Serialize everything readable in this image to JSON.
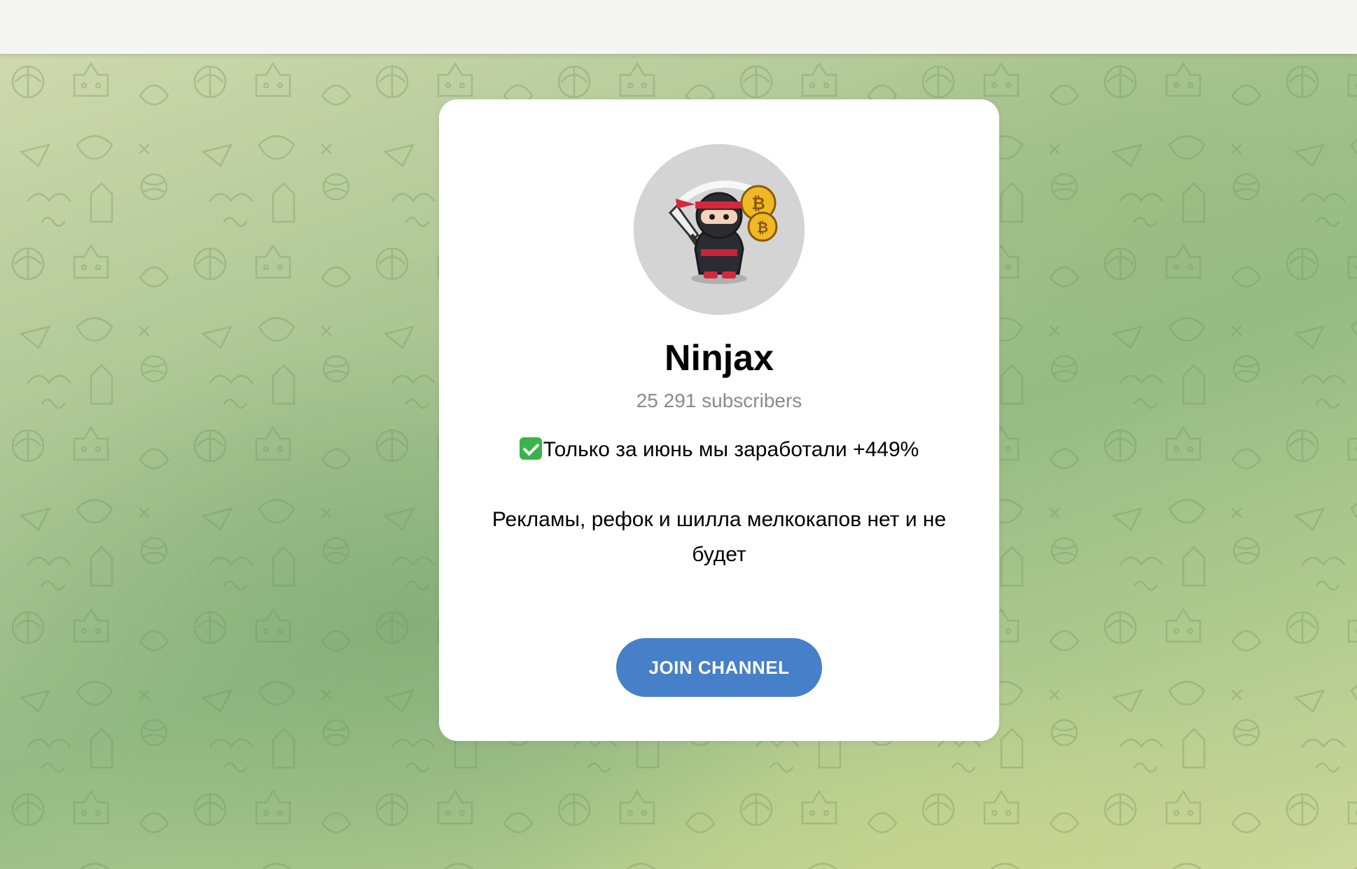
{
  "channel": {
    "title": "Ninjax",
    "subscribers": "25 291 subscribers",
    "description_line1": "Только за июнь мы заработали +449%",
    "description_line1_icon": "check-mark-button-emoji",
    "description_line2": "Рекламы, рефок и шилла мелкокапов нет и не будет",
    "avatar_icon": "ninja-with-bitcoin-avatar"
  },
  "actions": {
    "join_label": "JOIN CHANNEL"
  },
  "colors": {
    "accent": "#4680c8",
    "background_green": "#a9c492",
    "check_green": "#3cb34a"
  }
}
